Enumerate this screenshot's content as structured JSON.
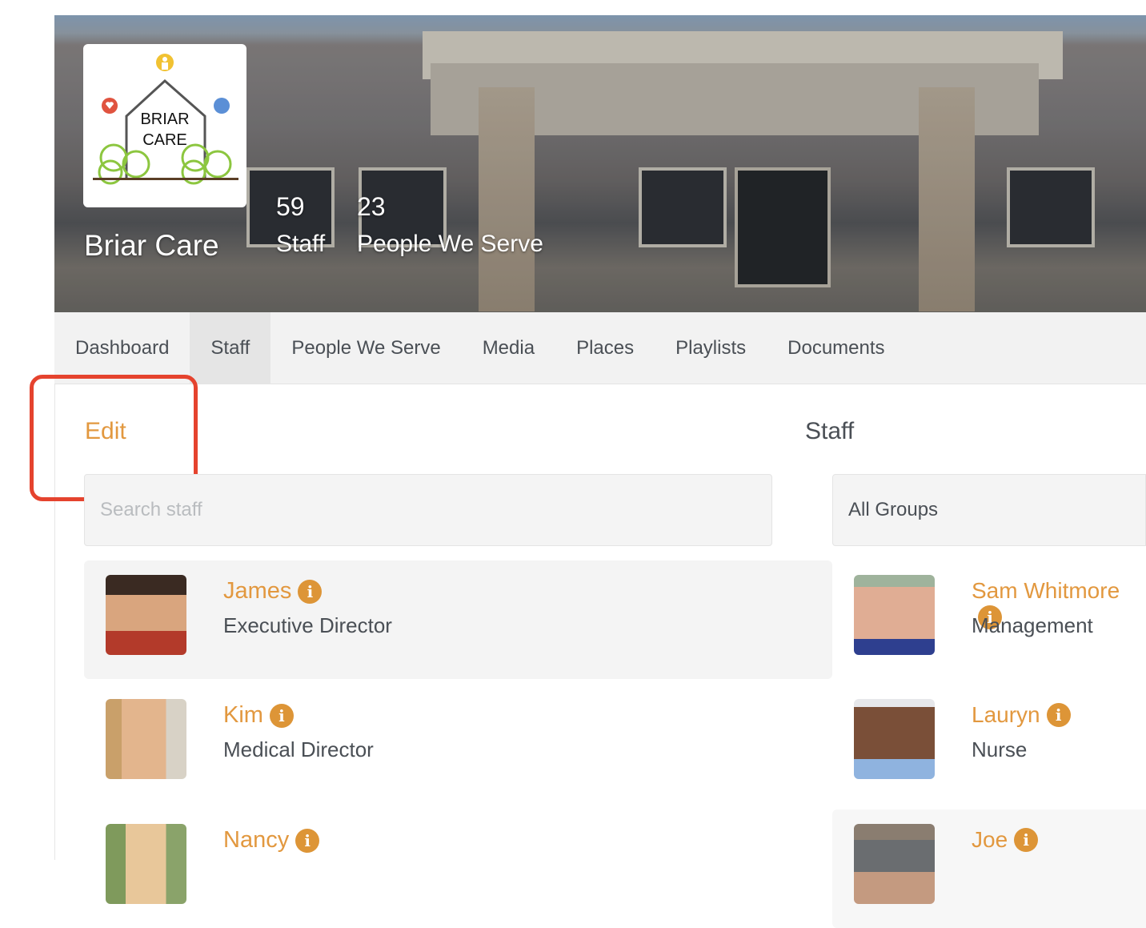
{
  "org": {
    "name": "Briar Care",
    "logo_text": "BRIAR CARE"
  },
  "stats": [
    {
      "value": "59",
      "label": "Staff"
    },
    {
      "value": "23",
      "label": "People We Serve"
    }
  ],
  "tabs": [
    "Dashboard",
    "Staff",
    "People We Serve",
    "Media",
    "Places",
    "Playlists",
    "Documents"
  ],
  "active_tab": "Staff",
  "edit_label": "Edit",
  "section_title": "Staff",
  "search": {
    "placeholder": "Search staff",
    "value": ""
  },
  "group_filter": {
    "selected": "All Groups"
  },
  "staff": [
    {
      "name": "James",
      "role": "Executive Director"
    },
    {
      "name": "Sam Whitmore",
      "role": "Management"
    },
    {
      "name": "Kim",
      "role": "Medical Director"
    },
    {
      "name": "Lauryn",
      "role": "Nurse"
    },
    {
      "name": "Nancy",
      "role": ""
    },
    {
      "name": "Joe",
      "role": ""
    }
  ],
  "colors": {
    "accent": "#e2983f",
    "highlight": "#e5432e"
  }
}
